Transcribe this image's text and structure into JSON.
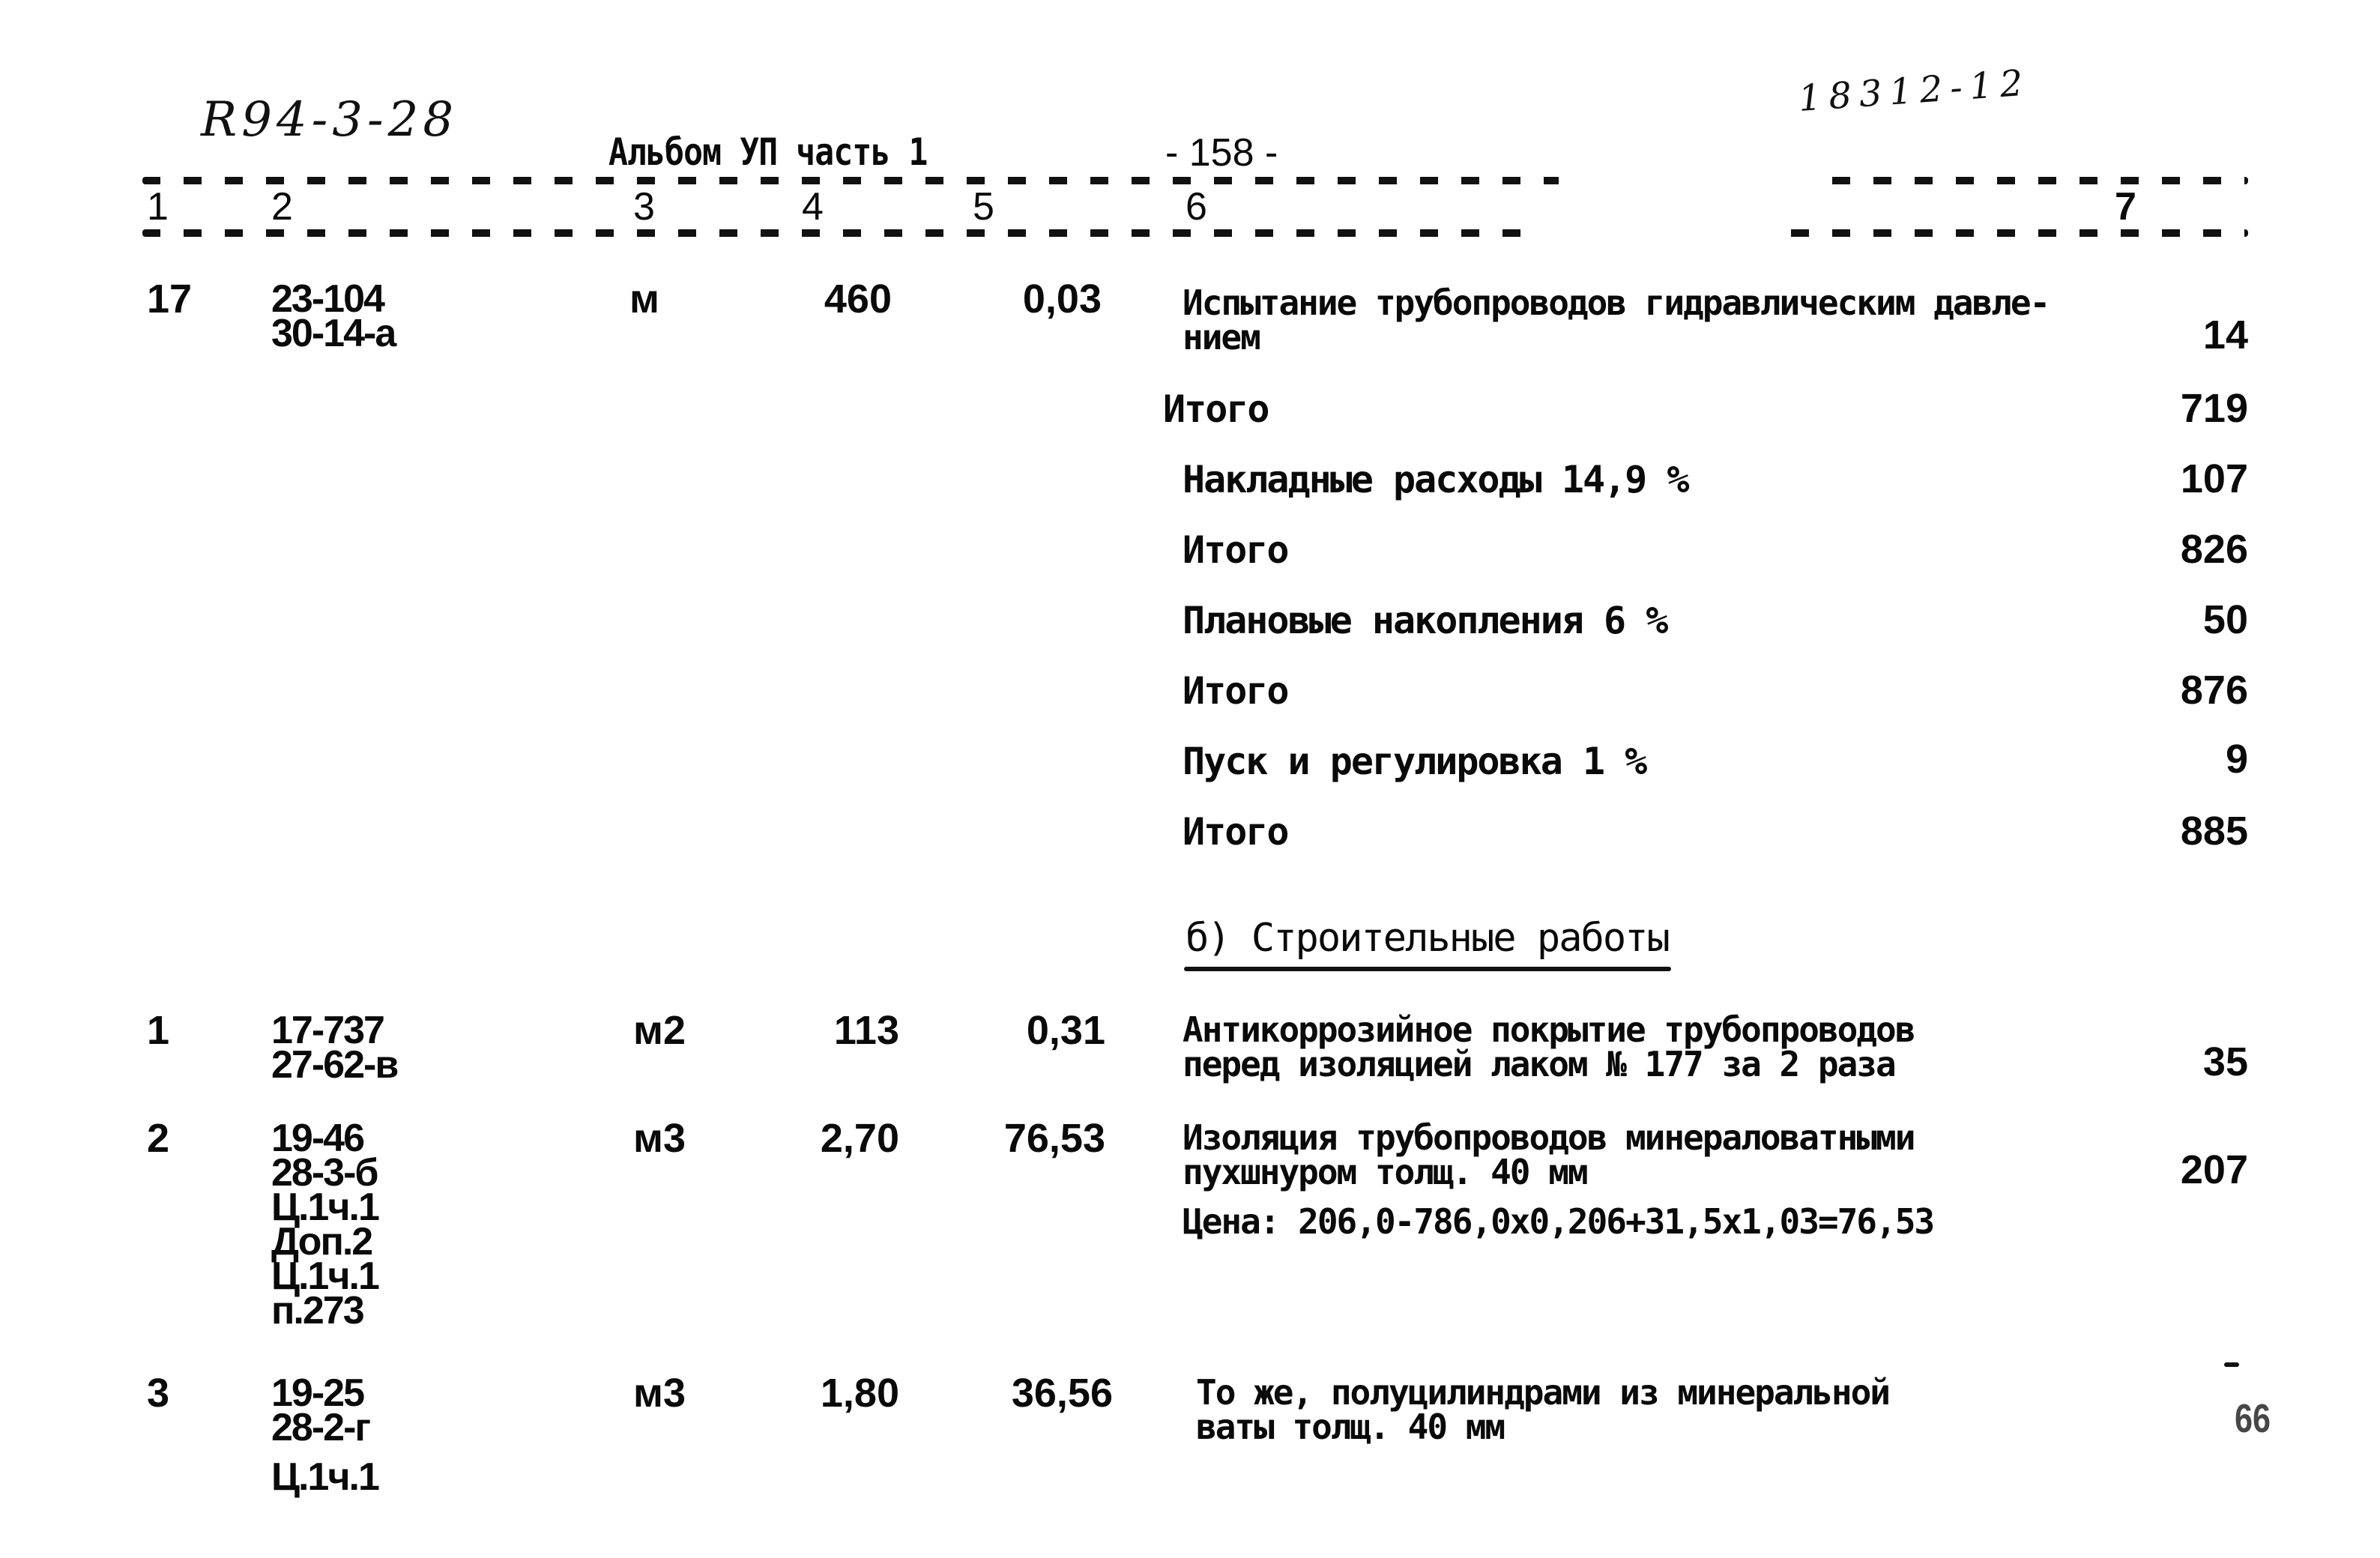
{
  "header": {
    "handwritten_left": "R94-3-28",
    "album": "Альбом УП часть 1",
    "page_number": "- 158 -",
    "handwritten_right": "18312-12"
  },
  "columns": [
    "1",
    "2",
    "3",
    "4",
    "5",
    "6",
    "7"
  ],
  "row17": {
    "num": "17",
    "codes": [
      "23-104",
      "30-14-а"
    ],
    "unit": "м",
    "qty": "460",
    "price": "0,03",
    "description": [
      "Испытание трубопроводов гидравлическим давле-",
      "нием"
    ],
    "total": "14"
  },
  "subtotals": [
    {
      "label": "Итого",
      "value": "719"
    },
    {
      "label": "Накладные расходы 14,9 %",
      "value": "107"
    },
    {
      "label": "Итого",
      "value": "826"
    },
    {
      "label": "Плановые накопления 6 %",
      "value": "50"
    },
    {
      "label": "Итого",
      "value": "876"
    },
    {
      "label": "Пуск и регулировка 1 %",
      "value": "9"
    },
    {
      "label": "Итого",
      "value": "885"
    }
  ],
  "section_b": {
    "title": "б) Строительные работы"
  },
  "rows_b": [
    {
      "num": "1",
      "codes": [
        "17-737",
        "27-62-в"
      ],
      "unit": "м2",
      "qty": "113",
      "price": "0,31",
      "description": [
        "Антикоррозийное покрытие трубопроводов",
        "перед изоляцией лаком № 177 за 2 раза"
      ],
      "note": "",
      "total": "35"
    },
    {
      "num": "2",
      "codes": [
        "19-46",
        "28-3-б",
        "Ц.1ч.1",
        "Доп.2",
        "Ц.1ч.1",
        "п.273"
      ],
      "unit": "м3",
      "qty": "2,70",
      "price": "76,53",
      "description": [
        "Изоляция трубопроводов минераловатными",
        "пухшнуром толщ. 40 мм"
      ],
      "note": "Цена: 206,0-786,0х0,206+31,5х1,03=76,53",
      "total": "207"
    },
    {
      "num": "3",
      "codes": [
        "19-25",
        "28-2-г",
        "Ц.1ч.1"
      ],
      "unit": "м3",
      "qty": "1,80",
      "price": "36,56",
      "description": [
        "То же, полуцилиндрами из минеральной",
        "ваты толщ. 40 мм"
      ],
      "note": "",
      "total": "66"
    }
  ]
}
